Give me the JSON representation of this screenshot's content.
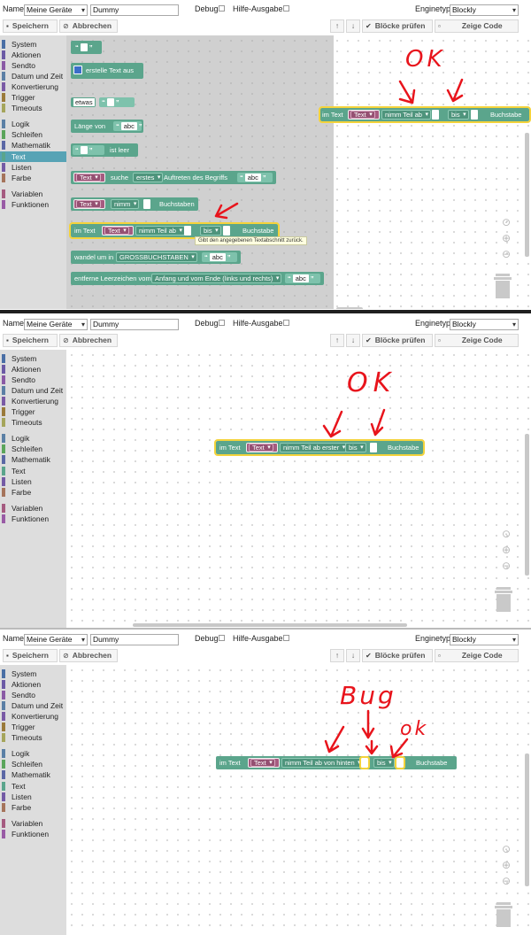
{
  "header": {
    "name_label": "Name",
    "name_select": "Meine Geräte",
    "name_input": "Dummy",
    "debug_label": "Debug",
    "hilfe_label": "Hilfe-Ausgaben",
    "enginetyp_label": "Enginetyp",
    "enginetyp_value": "Blockly"
  },
  "toolbar": {
    "save_label": "Speichern",
    "cancel_label": "Abbrechen",
    "check_label": "Blöcke prüfen",
    "code_label": "Zeige Code"
  },
  "toolbox": {
    "categories": [
      {
        "label": "System",
        "color": "#4a6fa5"
      },
      {
        "label": "Aktionen",
        "color": "#6b5aa5"
      },
      {
        "label": "Sendto",
        "color": "#8a5aa5"
      },
      {
        "label": "Datum und Zeit",
        "color": "#5b7fa5"
      },
      {
        "label": "Konvertierung",
        "color": "#7a5aa5"
      },
      {
        "label": "Trigger",
        "color": "#9a7a3a"
      },
      {
        "label": "Timeouts",
        "color": "#a5a55b"
      },
      {
        "label": "Logik",
        "color": "#5b80a5"
      },
      {
        "label": "Schleifen",
        "color": "#5ba55b"
      },
      {
        "label": "Mathematik",
        "color": "#5b67a5"
      },
      {
        "label": "Text",
        "color": "#5ba58c"
      },
      {
        "label": "Listen",
        "color": "#745ba5"
      },
      {
        "label": "Farbe",
        "color": "#a5745b"
      },
      {
        "label": "Variablen",
        "color": "#a55b80"
      },
      {
        "label": "Funktionen",
        "color": "#995ba5"
      }
    ]
  },
  "flyout": {
    "b2_text": "erstelle Text aus",
    "b3_var": "etwas",
    "b4_text": "Länge von",
    "b4_value": "abc",
    "b5_text": "ist leer",
    "b6_var": "Text",
    "b6_t1": "suche",
    "b6_dd": "erstes",
    "b6_t2": "Auftreten des Begriffs",
    "b6_value": "abc",
    "b7_var": "Text",
    "b7_dd": "nimm",
    "b7_t2": "Buchstaben",
    "b8_t1": "im Text",
    "b8_var": "Text",
    "b8_dd1": "nimm Teil ab",
    "b8_dd2": "bis",
    "b8_t2": "Buchstabe",
    "tooltip": "Gibt den angegebenen Textabschnitt zurück.",
    "b9_t1": "wandel um in",
    "b9_dd": "GROSSBUCHSTABEN",
    "b9_value": "abc",
    "b10_t1": "entferne Leerzeichen vom",
    "b10_dd": "Anfang und vom Ende (links und rechts)",
    "b10_value": "abc"
  },
  "panel1_block": {
    "t1": "im Text",
    "var": "Text",
    "dd1": "nimm Teil ab",
    "dd2": "bis",
    "t2": "Buchstabe"
  },
  "panel2_block": {
    "t1": "im Text",
    "var": "Text",
    "dd1": "nimm Teil ab erster",
    "dd2": "bis",
    "t2": "Buchstabe"
  },
  "panel3_block": {
    "t1": "im Text",
    "var": "Text",
    "dd1": "nimm Teil ab von hinten",
    "dd2": "bis",
    "t2": "Buchstabe"
  },
  "annotations": {
    "p1": "OK",
    "p2": "OK",
    "p3_bug": "Bug",
    "p3_ok": "ok"
  },
  "colors": {
    "text_block": "#5ba58c",
    "variable_block": "#a55b80",
    "highlight": "#f4d33b",
    "annotation": "#e8141c"
  }
}
